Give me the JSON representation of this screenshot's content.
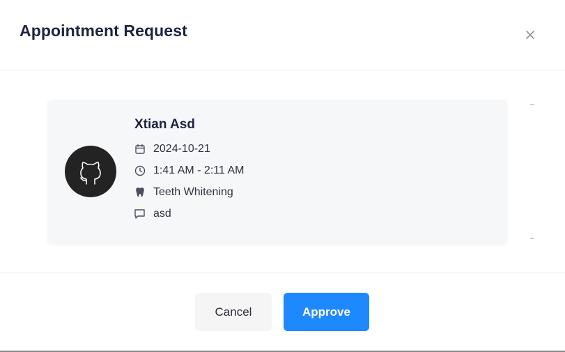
{
  "modal": {
    "title": "Appointment Request",
    "close_icon": "close-icon"
  },
  "appointment": {
    "patient_name": "Xtian Asd",
    "avatar_icon": "github-cat-icon",
    "date": "2024-10-21",
    "time": "1:41 AM - 2:11 AM",
    "service": "Teeth Whitening",
    "note": "asd",
    "icons": {
      "date": "calendar-icon",
      "time": "clock-icon",
      "service": "tooth-icon",
      "note": "comment-icon"
    }
  },
  "footer": {
    "cancel_label": "Cancel",
    "approve_label": "Approve"
  },
  "colors": {
    "primary": "#1e88ff",
    "title": "#1e2340",
    "card_background": "#f6f7f9",
    "avatar_background": "#232323"
  }
}
